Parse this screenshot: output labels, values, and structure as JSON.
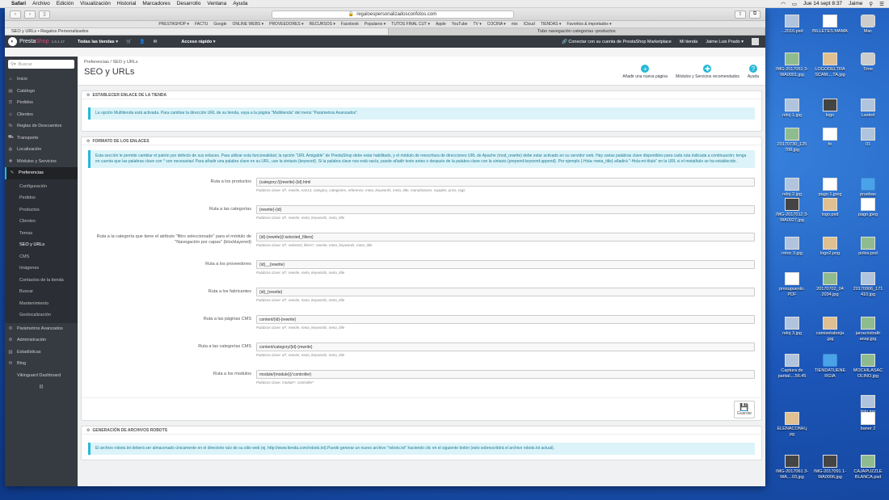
{
  "menubar": {
    "app": "Safari",
    "items": [
      "Archivo",
      "Edición",
      "Visualización",
      "Historial",
      "Marcadores",
      "Desarrollo",
      "Ventana",
      "Ayuda"
    ],
    "clock": "Jue 14 sept  8:37",
    "user": "Jaime"
  },
  "browser": {
    "url": "regaloespersonalizadosconfotos.com",
    "bookmarks": [
      "PRESTASHOP ▾",
      "FACTU",
      "Google",
      "ONLINE WEBS ▾",
      "PROVEEDORES ▾",
      "RECURSOS ▾",
      "Facebook",
      "Populares ▾",
      "TUTOS FINAL CUT ▾",
      "Apple",
      "YouTube",
      "TV ▾",
      "COCINA ▾",
      "mix",
      "iCloud",
      "TIENDAS ▾",
      "Favoritos & importados ▾"
    ],
    "tabs": [
      "SEO y URLs • Regalos Personalizados",
      "Tubo navegación categorías ›productos"
    ]
  },
  "psheader": {
    "brand_a": "Presta",
    "brand_b": "Shop",
    "version": "1.6.1.17",
    "stores": "Todas las tiendas ▾",
    "quick": "Acceso rápido ▾",
    "connect": "Conectar con su cuenta de PrestaShop Marketplace",
    "mystore": "Mi tienda",
    "user": "Jaime Luis Prado ▾"
  },
  "sidebar": {
    "search_placeholder": "Buscar",
    "items": [
      {
        "label": "Inicio",
        "icon": "⌂"
      },
      {
        "label": "Catálogo",
        "icon": "▤"
      },
      {
        "label": "Pedidos",
        "icon": "☰"
      },
      {
        "label": "Clientes",
        "icon": "☺"
      },
      {
        "label": "Reglas de Descuentos",
        "icon": "%"
      },
      {
        "label": "Transporte",
        "icon": "⛟"
      },
      {
        "label": "Localización",
        "icon": "◍"
      },
      {
        "label": "Módulos y Servicios",
        "icon": "✚"
      },
      {
        "label": "Preferencias",
        "icon": "✎"
      }
    ],
    "subitems": [
      "Configuración",
      "Pedidos",
      "Productos",
      "Clientes",
      "Temas",
      "SEO y URLs",
      "CMS",
      "Imágenes",
      "Contactos de la tienda",
      "Buscar",
      "Mantenimiento",
      "Geolocalización"
    ],
    "bottom": [
      {
        "label": "Parámetros Avanzados",
        "icon": "⚙"
      },
      {
        "label": "Administración",
        "icon": "⚙"
      },
      {
        "label": "Estadísticas",
        "icon": "▥"
      },
      {
        "label": "Blog",
        "icon": "✉"
      },
      {
        "label": "Vikinguard Dashboard",
        "icon": ""
      }
    ]
  },
  "page": {
    "breadcrumb": "Preferencias  /  SEO y URLs",
    "title": "SEO y URLs",
    "tools": [
      {
        "label": "Añadir una nueva página",
        "icon": "+"
      },
      {
        "label": "Módulos y Servicios recomendados",
        "icon": "✚"
      },
      {
        "label": "Ayuda",
        "icon": "?"
      }
    ]
  },
  "panel1": {
    "heading": "ESTABLECER ENLACE DE LA TIENDA",
    "alert": "La opción Multitienda está activada. Para cambiar la dirección URL de su tienda, vaya a la página \"Multitienda\" del menú \"Parámetros Avanzados\"."
  },
  "panel2": {
    "heading": "FORMATO DE LOS ENLACES",
    "alert": "Esta sección le permite cambiar el patrón por defecto de sus enlaces. Para utilizar esta funcionalidad, la opción \"URL Amigable\" de PrestaShop debe estar habilitado, y el módulo de reescritura de direcciones URL de Apache (mod_rewrite) debe estar activado en su servidor web. Hay varias palabras clave disponibles para cada ruta indicada a continuación; tenga en cuenta que las palabras clave con * son necesarias! Para añadir una palabra clave en su URL, use la sintaxis {keyword}. Si la palabra clave nos está vacía, puede añadir texto antes o después de la palabra clave con la sintaxis {prepend:keyword:append}. Por ejemplo {-Hola-:meta_title} añadirá \"-Hola-mi-título\" en la URL si el metatítulo se ha establecido.",
    "rows": [
      {
        "label": "Ruta a los productos",
        "value": "{category:/}{rewrite}-{id}.html",
        "help": "Palabras clave: id*, rewrite, ean13, category, categories, reference, meta_keywords, meta_title, manufacturer, supplier, price, tags"
      },
      {
        "label": "Ruta a las categorías",
        "value": "{rewrite}-{id}",
        "help": "Palabras clave: id*, rewrite, meta_keywords, meta_title"
      },
      {
        "label": "Ruta a la categoría que tiene el atributo \"filtro seleccionado\" para el módulo de \"Navegación por capas\" (blocklayered)",
        "value": "{id}-{rewrite}{/:selected_filters}",
        "help": "Palabras clave: id*, selected_filters*, rewrite, meta_keywords, meta_title"
      },
      {
        "label": "Ruta a los proveedores",
        "value": "{id}__{rewrite}",
        "help": "Palabras clave: id*, rewrite, meta_keywords, meta_title"
      },
      {
        "label": "Ruta a los fabricantes",
        "value": "{id}_{rewrite}",
        "help": "Palabras clave: id*, rewrite, meta_keywords, meta_title"
      },
      {
        "label": "Ruta a las páginas CMS",
        "value": "content/{id}-{rewrite}",
        "help": "Palabras clave: id*, rewrite, meta_keywords, meta_title"
      },
      {
        "label": "Ruta a las categorías CMS",
        "value": "content/category/{id}-{rewrite}",
        "help": "Palabras clave: id*, rewrite, meta_keywords, meta_title"
      },
      {
        "label": "Ruta a los modulos",
        "value": "module/{module}{/:controller}",
        "help": "Palabras clave: module*, controller*"
      }
    ],
    "save": "Guardar"
  },
  "panel3": {
    "heading": "GENERACIÓN DE ARCHIVOS ROBOTS",
    "alert": "El archivo robots.txt deberá ser almacenado únicamente en el directorio raíz de su sitio web (ej. http://www.tienda.com/robots.txt).Puede generar un nuevo archivo \"robots.txt\" haciendo clic en el siguiente botón (esto sobrescribirá el archivo robots.txt actual)."
  },
  "desktop": [
    {
      "label": "...2016.psd",
      "kind": "imgA"
    },
    {
      "label": "BILLETES MAMA",
      "kind": "pdf"
    },
    {
      "label": "Mac",
      "kind": "drive"
    },
    {
      "label": "IMG-2017061 3-WA0001.jpg",
      "kind": "imgB"
    },
    {
      "label": "LOGODELTRA SCAM....TA.jpg",
      "kind": "imgC"
    },
    {
      "label": "Time",
      "kind": "drive"
    },
    {
      "label": "reloj 1.jpg",
      "kind": "imgA"
    },
    {
      "label": "logo",
      "kind": "dark"
    },
    {
      "label": "Lasted",
      "kind": "imgA"
    },
    {
      "label": "20170730_125 708.jpg",
      "kind": "imgB"
    },
    {
      "label": "fe",
      "kind": "pdf"
    },
    {
      "label": "01",
      "kind": "imgA"
    },
    {
      "label": "reloj 2.jpg",
      "kind": "imgA"
    },
    {
      "label": "pago 1.jpeg",
      "kind": "pdf"
    },
    {
      "label": "pruebas",
      "kind": "folder"
    },
    {
      "label": "IMG-2017012 3-WA0027.jpg",
      "kind": "dark"
    },
    {
      "label": "logo.psd",
      "kind": "imgC"
    },
    {
      "label": "pago.jpeg",
      "kind": "pdf"
    },
    {
      "label": "retoc 3.jpg",
      "kind": "imgA"
    },
    {
      "label": "logo2.png",
      "kind": "imgC"
    },
    {
      "label": "polos.psd",
      "kind": "imgB"
    },
    {
      "label": "presupuesto. PDF",
      "kind": "pdf"
    },
    {
      "label": "20170702_04 2034.jpg",
      "kind": "imgB"
    },
    {
      "label": "20170906_171 410.jpg",
      "kind": "imgA"
    },
    {
      "label": "reloj 3.jpg",
      "kind": "imgA"
    },
    {
      "label": "camisetaborja .jpg",
      "kind": "imgC"
    },
    {
      "label": "jarracristraltr ansp.jpg",
      "kind": "imgB"
    },
    {
      "label": "Captura de pantal....56.45",
      "kind": "imgA"
    },
    {
      "label": "TIENDATUENE RGIA",
      "kind": "folder"
    },
    {
      "label": "MOCHILASAC OLINO.jpg",
      "kind": "imgB"
    },
    {
      "label": "foto.jpg",
      "kind": "imgA"
    },
    {
      "label": "ELENACONH.j pg",
      "kind": "imgC"
    },
    {
      "label": "baner 2",
      "kind": "pdf"
    },
    {
      "label": "IMG-2017061 3-WA....03.jpg",
      "kind": "dark"
    },
    {
      "label": "IMG-2017091 1-WA0006.jpg",
      "kind": "dark"
    },
    {
      "label": "CAJAPUZZLE BLANCA.psd",
      "kind": "imgB"
    }
  ]
}
